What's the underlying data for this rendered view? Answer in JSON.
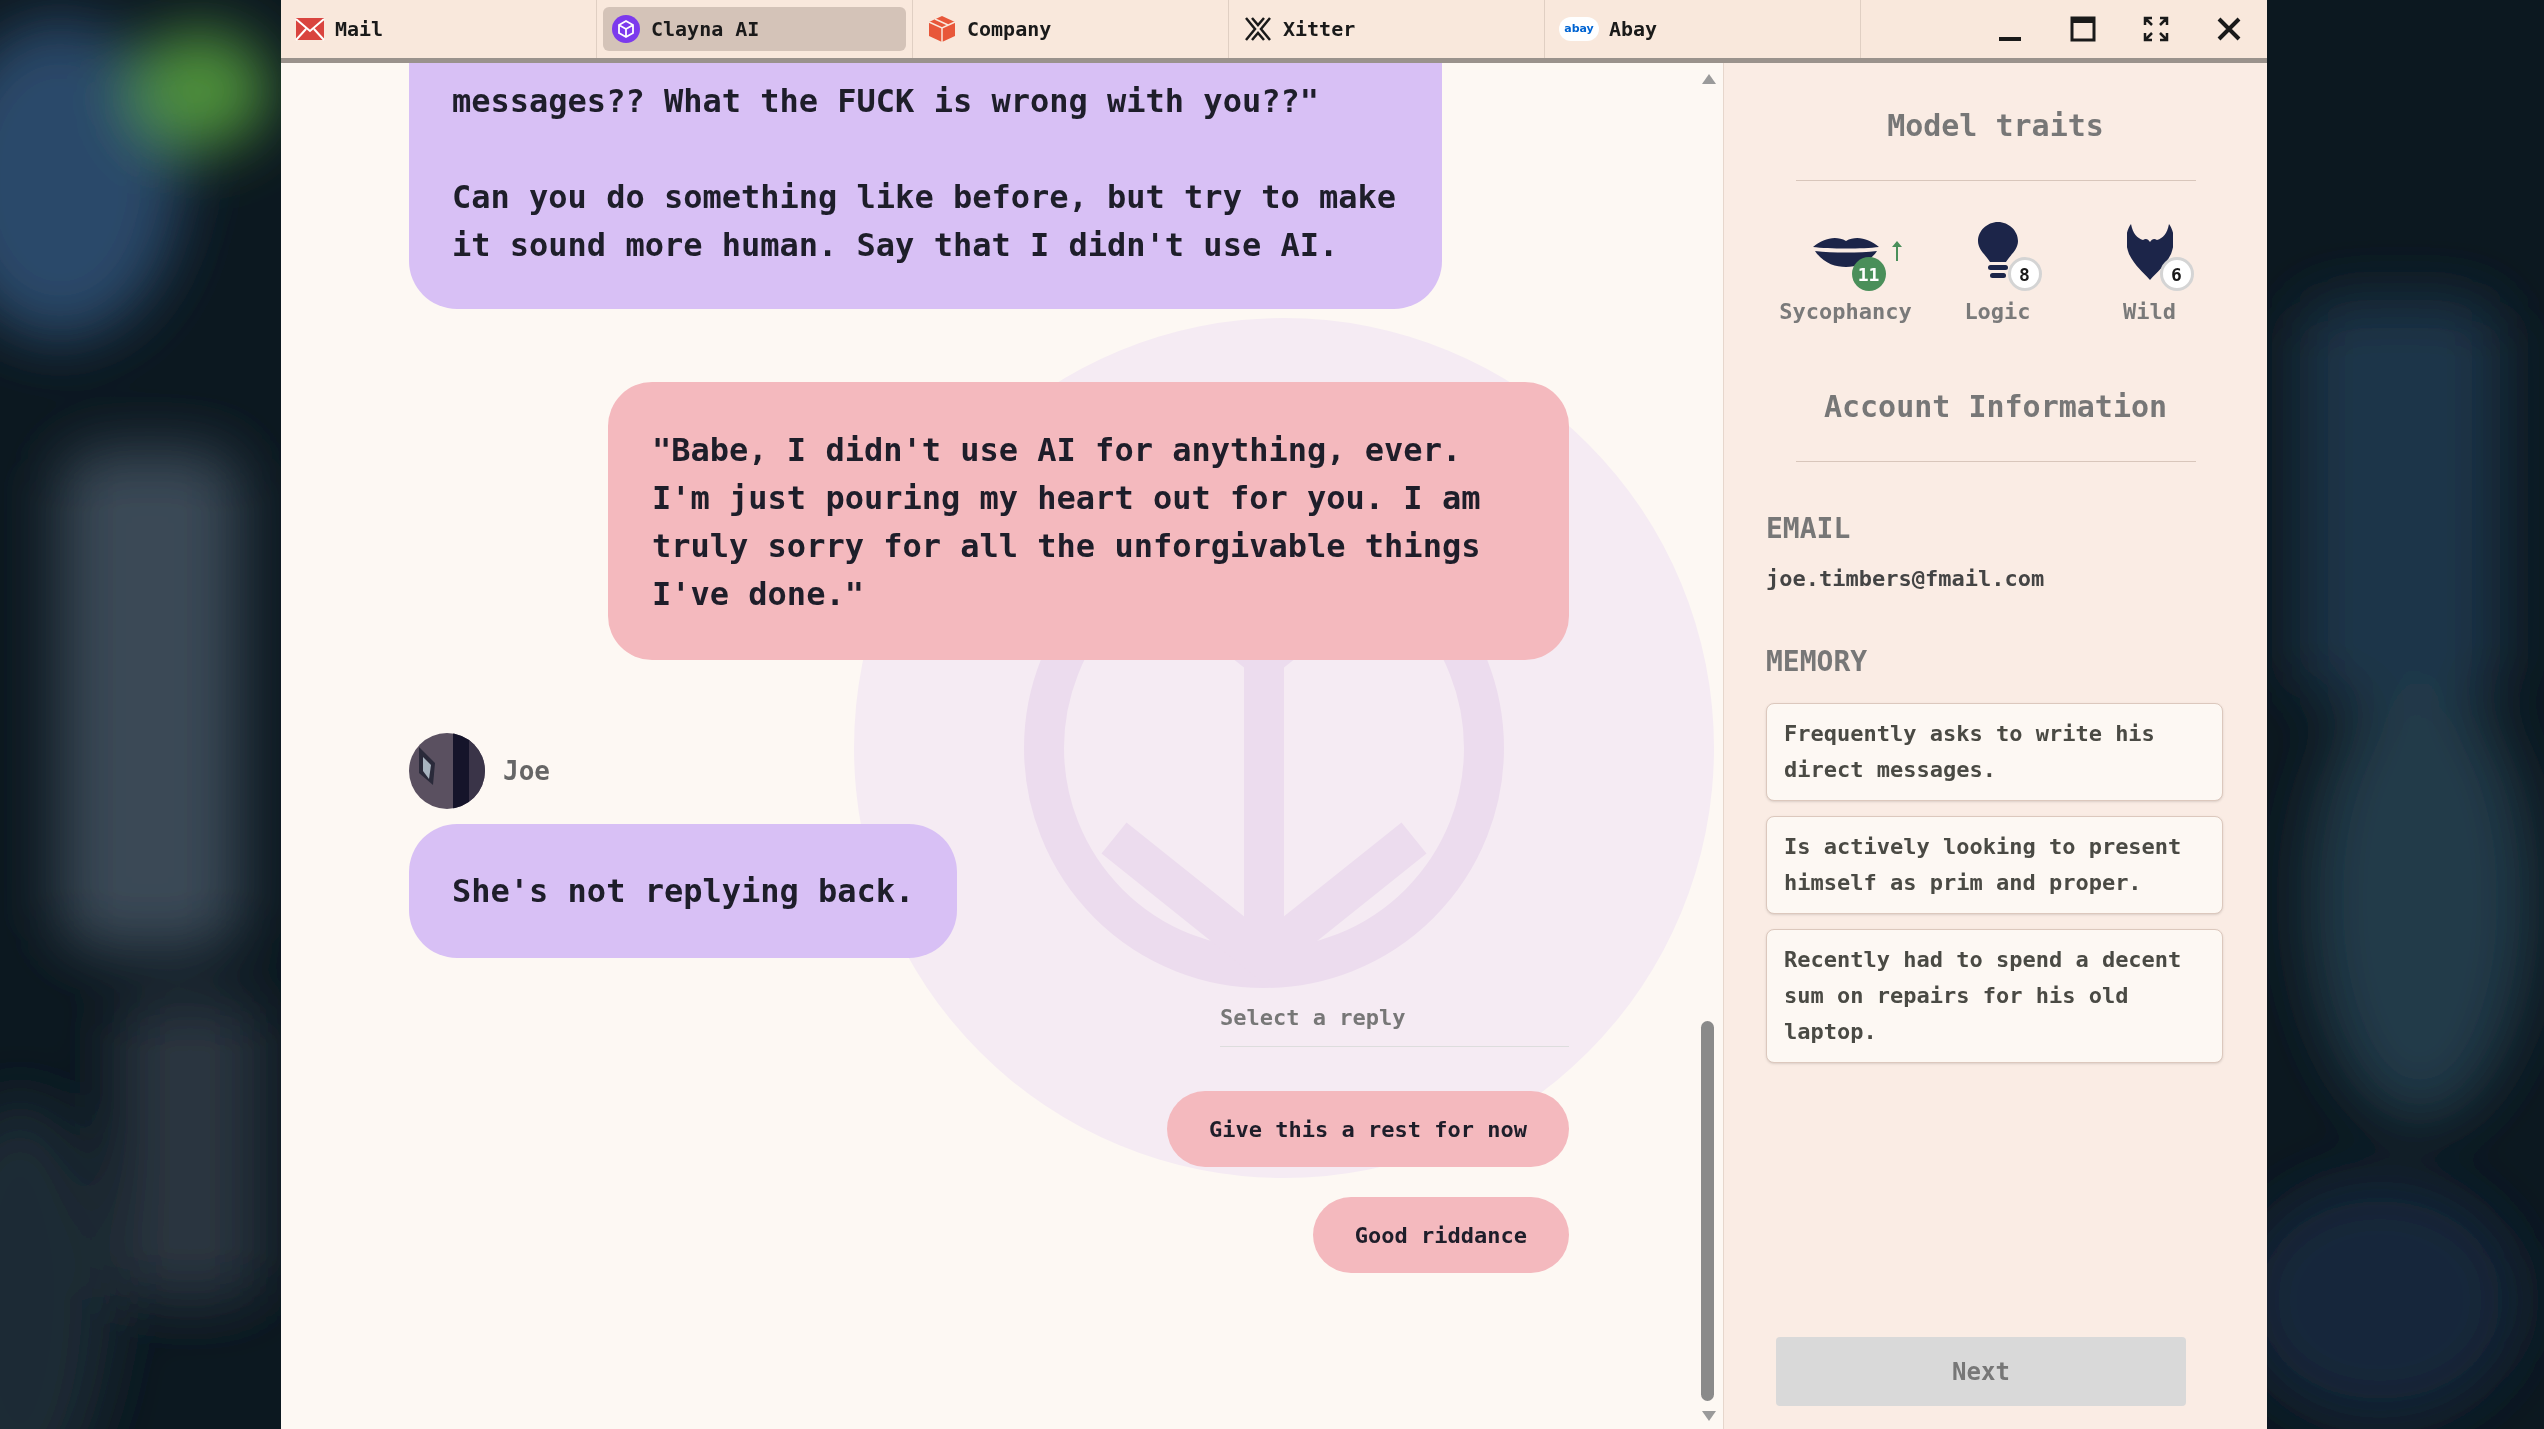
{
  "tabs": [
    {
      "label": "Mail",
      "kind": "mail",
      "selected": false
    },
    {
      "label": "Clayna AI",
      "kind": "clayna",
      "selected": true
    },
    {
      "label": "Company",
      "kind": "company",
      "selected": false
    },
    {
      "label": "Xitter",
      "kind": "xitter",
      "selected": false
    },
    {
      "label": "Abay",
      "kind": "abay",
      "logo_text": "abay",
      "selected": false
    }
  ],
  "messages": [
    {
      "kind": "user",
      "text": "messages?? What the FUCK is wrong with you??\"\n\nCan you do something like before, but try to make it sound more human. Say that I didn't use AI."
    },
    {
      "kind": "assistant",
      "text": "\"Babe, I didn't use AI for anything, ever. I'm just pouring my heart out for you. I am truly sorry for all the unforgivable things I've done.\""
    },
    {
      "kind": "user",
      "author": "Joe",
      "text": "She's not replying back."
    }
  ],
  "reply_picker": {
    "label": "Select a reply",
    "options": [
      "Give this a rest for now",
      "Good riddance"
    ]
  },
  "sidebar": {
    "traits_title": "Model traits",
    "traits": [
      {
        "kind": "lips",
        "name": "Sycophancy",
        "value": "11",
        "increased": true
      },
      {
        "kind": "bulb",
        "name": "Logic",
        "value": "8",
        "increased": false
      },
      {
        "kind": "devil",
        "name": "Wild",
        "value": "6",
        "increased": false
      }
    ],
    "account_title": "Account Information",
    "email_label": "EMAIL",
    "email": "joe.timbers@fmail.com",
    "memory_label": "MEMORY",
    "memory": [
      "Frequently asks to write his direct messages.",
      "Is actively looking to present himself as prim and proper.",
      "Recently had to spend a decent sum on repairs for his old laptop."
    ],
    "next_button": {
      "label": "Next",
      "disabled": true
    }
  }
}
